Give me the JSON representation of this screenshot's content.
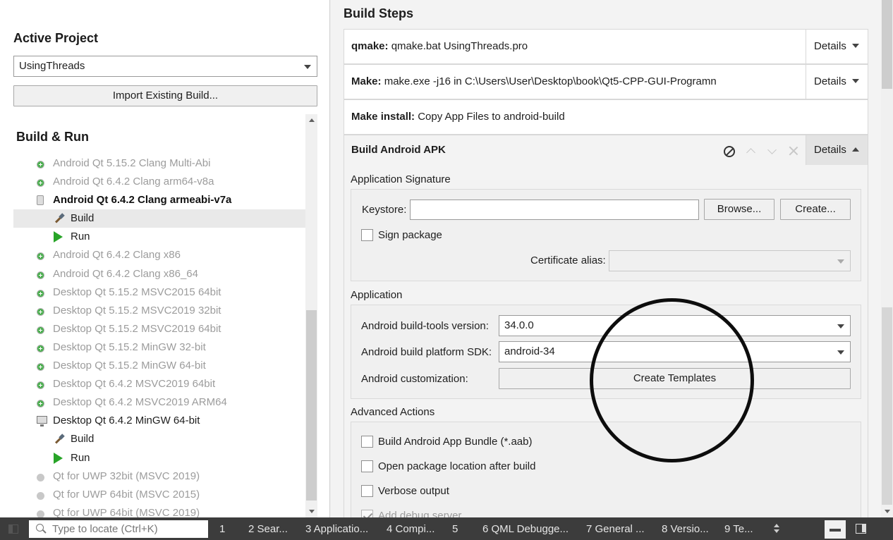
{
  "left": {
    "active_project_title": "Active Project",
    "project_selected": "UsingThreads",
    "import_button": "Import Existing Build...",
    "build_run_title": "Build & Run",
    "tree": [
      {
        "label": "Android Qt 5.15.2 Clang Multi-Abi",
        "level": 1,
        "icon": "add-kit-icon",
        "style": "dim"
      },
      {
        "label": "Android Qt 6.4.2 Clang arm64-v8a",
        "level": 1,
        "icon": "add-kit-icon",
        "style": "dim"
      },
      {
        "label": "Android Qt 6.4.2 Clang armeabi-v7a",
        "level": 1,
        "icon": "android-device-icon",
        "style": "bold"
      },
      {
        "label": "Build",
        "level": 2,
        "icon": "hammer-icon",
        "style": "normal",
        "selected": true
      },
      {
        "label": "Run",
        "level": 2,
        "icon": "run-icon",
        "style": "normal"
      },
      {
        "label": "Android Qt 6.4.2 Clang x86",
        "level": 1,
        "icon": "add-kit-icon",
        "style": "dim"
      },
      {
        "label": "Android Qt 6.4.2 Clang x86_64",
        "level": 1,
        "icon": "add-kit-icon",
        "style": "dim"
      },
      {
        "label": "Desktop Qt 5.15.2 MSVC2015 64bit",
        "level": 1,
        "icon": "add-kit-icon",
        "style": "dim"
      },
      {
        "label": "Desktop Qt 5.15.2 MSVC2019 32bit",
        "level": 1,
        "icon": "add-kit-icon",
        "style": "dim"
      },
      {
        "label": "Desktop Qt 5.15.2 MSVC2019 64bit",
        "level": 1,
        "icon": "add-kit-icon",
        "style": "dim"
      },
      {
        "label": "Desktop Qt 5.15.2 MinGW 32-bit",
        "level": 1,
        "icon": "add-kit-icon",
        "style": "dim"
      },
      {
        "label": "Desktop Qt 5.15.2 MinGW 64-bit",
        "level": 1,
        "icon": "add-kit-icon",
        "style": "dim"
      },
      {
        "label": "Desktop Qt 6.4.2 MSVC2019 64bit",
        "level": 1,
        "icon": "add-kit-icon",
        "style": "dim"
      },
      {
        "label": "Desktop Qt 6.4.2 MSVC2019 ARM64",
        "level": 1,
        "icon": "add-kit-icon",
        "style": "dim"
      },
      {
        "label": "Desktop Qt 6.4.2 MinGW 64-bit",
        "level": 1,
        "icon": "desktop-monitor-icon",
        "style": "normal"
      },
      {
        "label": "Build",
        "level": 2,
        "icon": "hammer-icon",
        "style": "normal"
      },
      {
        "label": "Run",
        "level": 2,
        "icon": "run-icon",
        "style": "normal"
      },
      {
        "label": "Qt  for UWP 32bit (MSVC 2019)",
        "level": 1,
        "icon": "disabled-kit-icon",
        "style": "dim"
      },
      {
        "label": "Qt  for UWP 64bit (MSVC 2015)",
        "level": 1,
        "icon": "disabled-kit-icon",
        "style": "dim"
      },
      {
        "label": "Qt  for UWP 64bit (MSVC 2019)",
        "level": 1,
        "icon": "disabled-kit-icon",
        "style": "dim"
      }
    ]
  },
  "right": {
    "build_steps_title": "Build Steps",
    "details_label": "Details",
    "steps": [
      {
        "name": "qmake:",
        "command": "qmake.bat UsingThreads.pro"
      },
      {
        "name": "Make:",
        "command": "make.exe -j16 in C:\\Users\\User\\Desktop\\book\\Qt5-CPP-GUI-Programn"
      },
      {
        "name": "Make install:",
        "command": "Copy App Files to android-build"
      }
    ],
    "apk_title": "Build Android APK",
    "signature": {
      "group_title": "Application Signature",
      "keystore_label": "Keystore:",
      "keystore_value": "",
      "browse_button": "Browse...",
      "create_button": "Create...",
      "sign_package_label": "Sign package",
      "certificate_alias_label": "Certificate alias:",
      "certificate_alias_value": ""
    },
    "application": {
      "group_title": "Application",
      "build_tools_label": "Android build-tools version:",
      "build_tools_value": "34.0.0",
      "platform_sdk_label": "Android build platform SDK:",
      "platform_sdk_value": "android-34",
      "customization_label": "Android customization:",
      "create_templates_button": "Create Templates"
    },
    "advanced": {
      "group_title": "Advanced Actions",
      "options": [
        {
          "label": "Build Android App Bundle (*.aab)",
          "checked": false
        },
        {
          "label": "Open package location after build",
          "checked": false
        },
        {
          "label": "Verbose output",
          "checked": false
        },
        {
          "label": "Add debug server",
          "checked": true
        }
      ]
    }
  },
  "statusbar": {
    "locate_placeholder": "Type to locate (Ctrl+K)",
    "tabs": [
      {
        "label": "1"
      },
      {
        "label": "2  Sear..."
      },
      {
        "label": "3  Applicatio..."
      },
      {
        "label": "4  Compi..."
      },
      {
        "label": "5"
      },
      {
        "label": "6  QML Debugge..."
      },
      {
        "label": "7  General ..."
      },
      {
        "label": "8  Versio..."
      },
      {
        "label": "9  Te..."
      }
    ]
  },
  "colors": {
    "statusbar_bg": "#3c3c3c",
    "run_green": "#28a428",
    "add_kit_green": "#4caf50",
    "annotation_circle": "#0d0d0d"
  }
}
